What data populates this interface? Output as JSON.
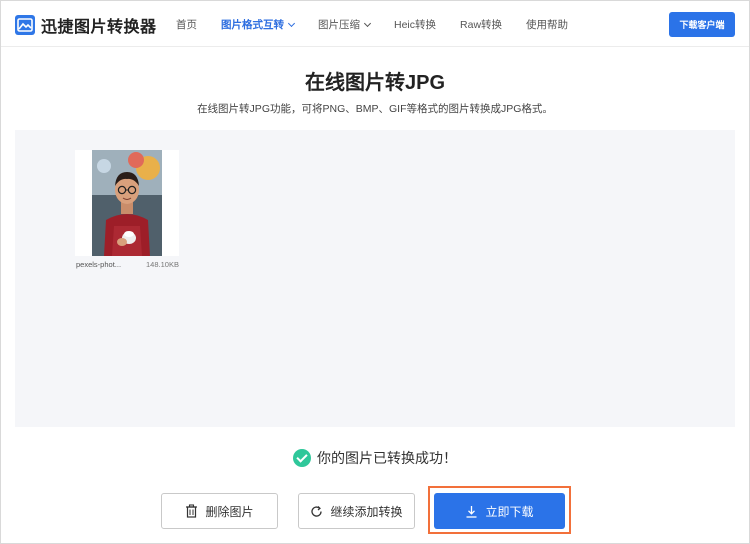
{
  "header": {
    "logo_text": "迅捷图片转换器",
    "nav": [
      {
        "label": "首页"
      },
      {
        "label": "图片格式互转"
      },
      {
        "label": "图片压缩"
      },
      {
        "label": "Heic转换"
      },
      {
        "label": "Raw转换"
      },
      {
        "label": "使用帮助"
      }
    ],
    "download_client": "下载客户端"
  },
  "main": {
    "title": "在线图片转JPG",
    "subtitle": "在线图片转JPG功能，可将PNG、BMP、GIF等格式的图片转换成JPG格式。"
  },
  "file": {
    "name": "pexels-phot...",
    "size": "148.10KB"
  },
  "status": {
    "message": "你的图片已转换成功！"
  },
  "actions": {
    "delete": "删除图片",
    "continue": "继续添加转换",
    "download": "立即下载"
  },
  "colors": {
    "accent": "#2b73e8",
    "success": "#2fc79a",
    "highlight": "#f2703a"
  }
}
